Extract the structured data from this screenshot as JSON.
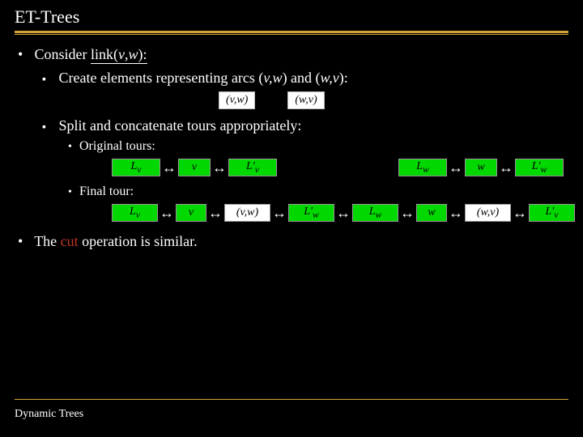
{
  "title": "ET-Trees",
  "bullet1_pre": "Consider ",
  "bullet1_link": "link(v,w):",
  "sub1_pre": "Create elements representing arcs (",
  "sub1_vw": "v,w",
  "sub1_mid": ") and (",
  "sub1_wv": "w,v",
  "sub1_post": "):",
  "arc_vw": "(v,w)",
  "arc_wv": "(w,v)",
  "sub2": "Split and concatenate tours appropriately:",
  "orig_label": "Original tours:",
  "final_label": "Final tour:",
  "boxes": {
    "Lv": "L",
    "Lv_sub": "v",
    "v": "v",
    "Lpv": "L'",
    "Lpv_sub": "v",
    "Lw": "L",
    "Lw_sub": "w",
    "w": "w",
    "Lpw": "L'",
    "Lpw_sub": "w",
    "vw": "(v,w)",
    "wv": "(w,v)"
  },
  "bullet2_pre": "The ",
  "bullet2_cut": "cut",
  "bullet2_post": " operation is similar.",
  "footer": "Dynamic Trees"
}
